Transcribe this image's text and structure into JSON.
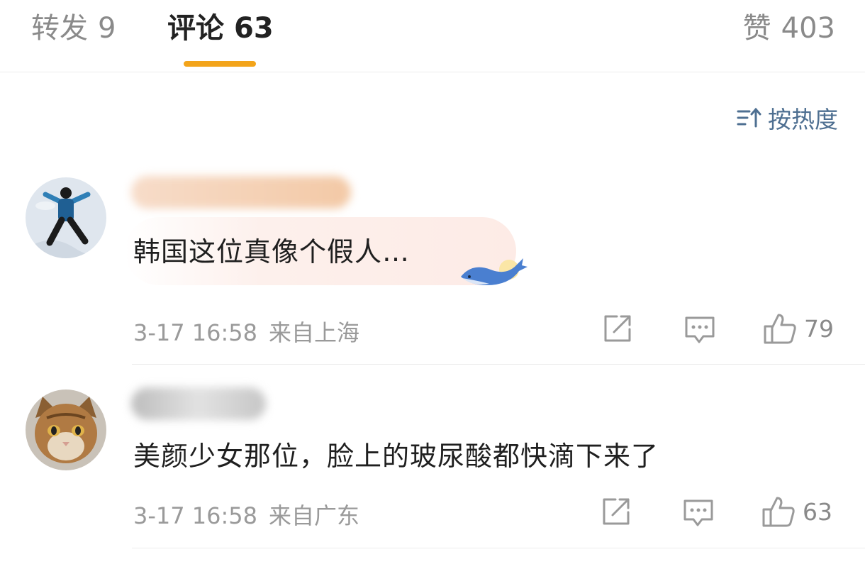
{
  "tabs": {
    "forward": {
      "label": "转发",
      "count": "9"
    },
    "comments": {
      "label": "评论",
      "count": "63"
    },
    "likes": {
      "label": "赞",
      "count": "403"
    }
  },
  "sort": {
    "label": "按热度"
  },
  "comments": [
    {
      "text": "韩国这位真像个假人…",
      "time": "3-17 16:58",
      "location": "来自上海",
      "likes": "79"
    },
    {
      "text": "美颜少女那位，脸上的玻尿酸都快滴下来了",
      "time": "3-17 16:58",
      "location": "来自广东",
      "likes": "63"
    }
  ],
  "colors": {
    "accent": "#f3a41a",
    "link": "#4e6f91",
    "meta": "#9a9a9a"
  },
  "icons": [
    "sort-icon",
    "share-icon",
    "reply-icon",
    "thumbs-up-icon",
    "whale-sticker-icon"
  ]
}
